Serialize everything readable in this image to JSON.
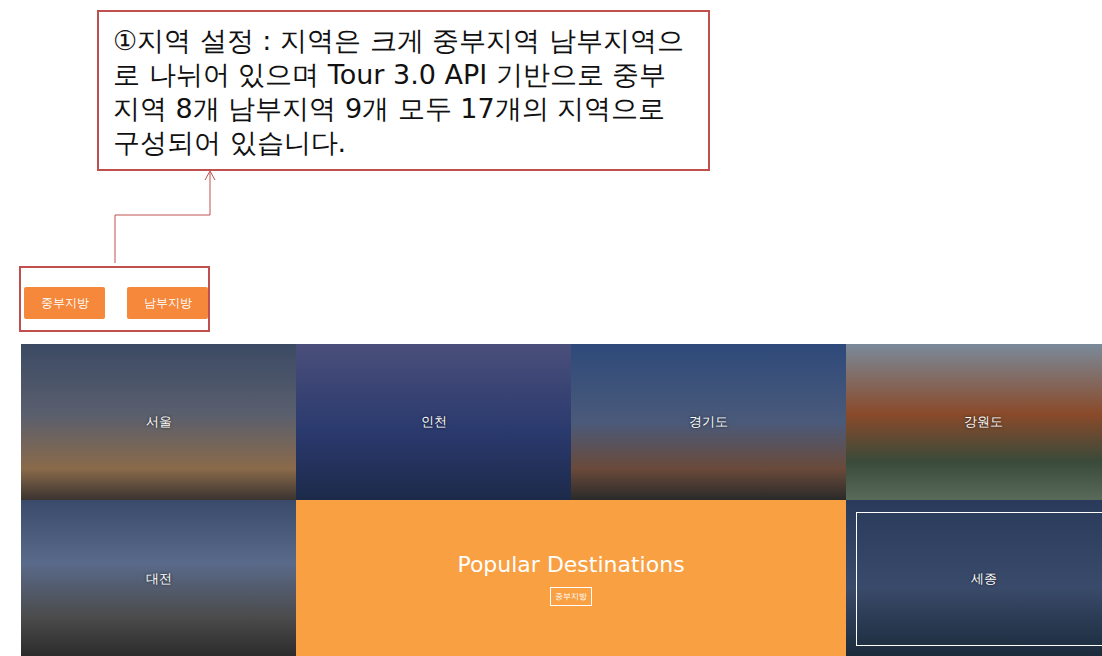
{
  "callout": {
    "text": "①지역 설정 : 지역은 크게 중부지역 남부지역으로 나뉘어 있으며 Tour 3.0 API 기반으로 중부지역 8개 남부지역 9개 모두 17개의 지역으로 구성되어 있습니다."
  },
  "region_buttons": [
    {
      "label": "중부지방",
      "selected": false
    },
    {
      "label": "남부지방",
      "selected": false
    }
  ],
  "tiles": [
    {
      "kind": "photo",
      "label": "서울",
      "highlighted": false
    },
    {
      "kind": "photo",
      "label": "인천",
      "highlighted": false
    },
    {
      "kind": "photo",
      "label": "경기도",
      "highlighted": false
    },
    {
      "kind": "photo",
      "label": "강원도",
      "highlighted": false
    },
    {
      "kind": "photo",
      "label": "대전",
      "highlighted": false
    },
    {
      "kind": "feature",
      "title": "Popular Destinations",
      "button": "중부지방"
    },
    {
      "kind": "photo",
      "label": "세종",
      "highlighted": true
    }
  ]
}
